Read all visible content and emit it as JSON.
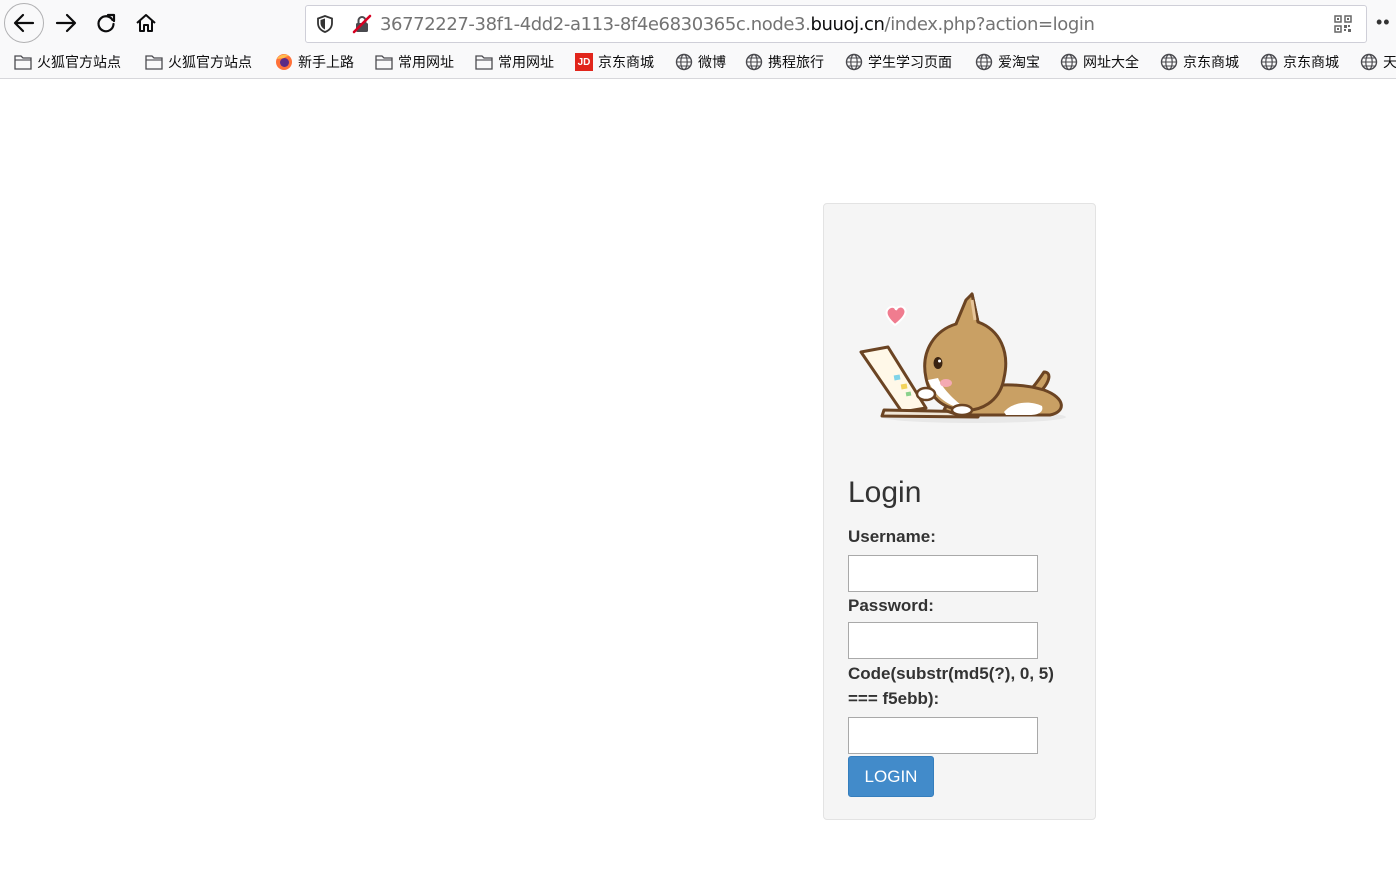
{
  "browser": {
    "url_prefix": "36772227-38f1-4dd2-a113-8f4e6830365c.node3.",
    "url_host": "buuoj.cn",
    "url_path": "/index.php?action=login",
    "overflow_label": "••"
  },
  "bookmarks": [
    {
      "label": "火狐官方站点",
      "icon": "folder-icon"
    },
    {
      "label": "火狐官方站点",
      "icon": "folder-icon"
    },
    {
      "label": "新手上路",
      "icon": "firefox-icon"
    },
    {
      "label": "常用网址",
      "icon": "folder-icon"
    },
    {
      "label": "常用网址",
      "icon": "folder-icon"
    },
    {
      "label": "京东商城",
      "icon": "jd-icon",
      "icon_text": "JD"
    },
    {
      "label": "微博",
      "icon": "globe-icon"
    },
    {
      "label": "携程旅行",
      "icon": "globe-icon"
    },
    {
      "label": "学生学习页面",
      "icon": "globe-icon"
    },
    {
      "label": "爱淘宝",
      "icon": "globe-icon"
    },
    {
      "label": "网址大全",
      "icon": "globe-icon"
    },
    {
      "label": "京东商城",
      "icon": "globe-icon"
    },
    {
      "label": "京东商城",
      "icon": "globe-icon"
    },
    {
      "label": "天",
      "icon": "globe-icon"
    }
  ],
  "login": {
    "title": "Login",
    "username_label": "Username:",
    "username_value": "",
    "password_label": "Password:",
    "password_value": "",
    "code_label_line1": "Code(substr(md5(?), 0, 5)",
    "code_label_line2": "=== f5ebb):",
    "code_value": "",
    "button_label": "LOGIN"
  },
  "colors": {
    "button": "#428bca",
    "panel": "#f5f5f5",
    "mascot_body": "#c9a064",
    "mascot_outline": "#6b4423",
    "heart": "#f07c8f"
  }
}
